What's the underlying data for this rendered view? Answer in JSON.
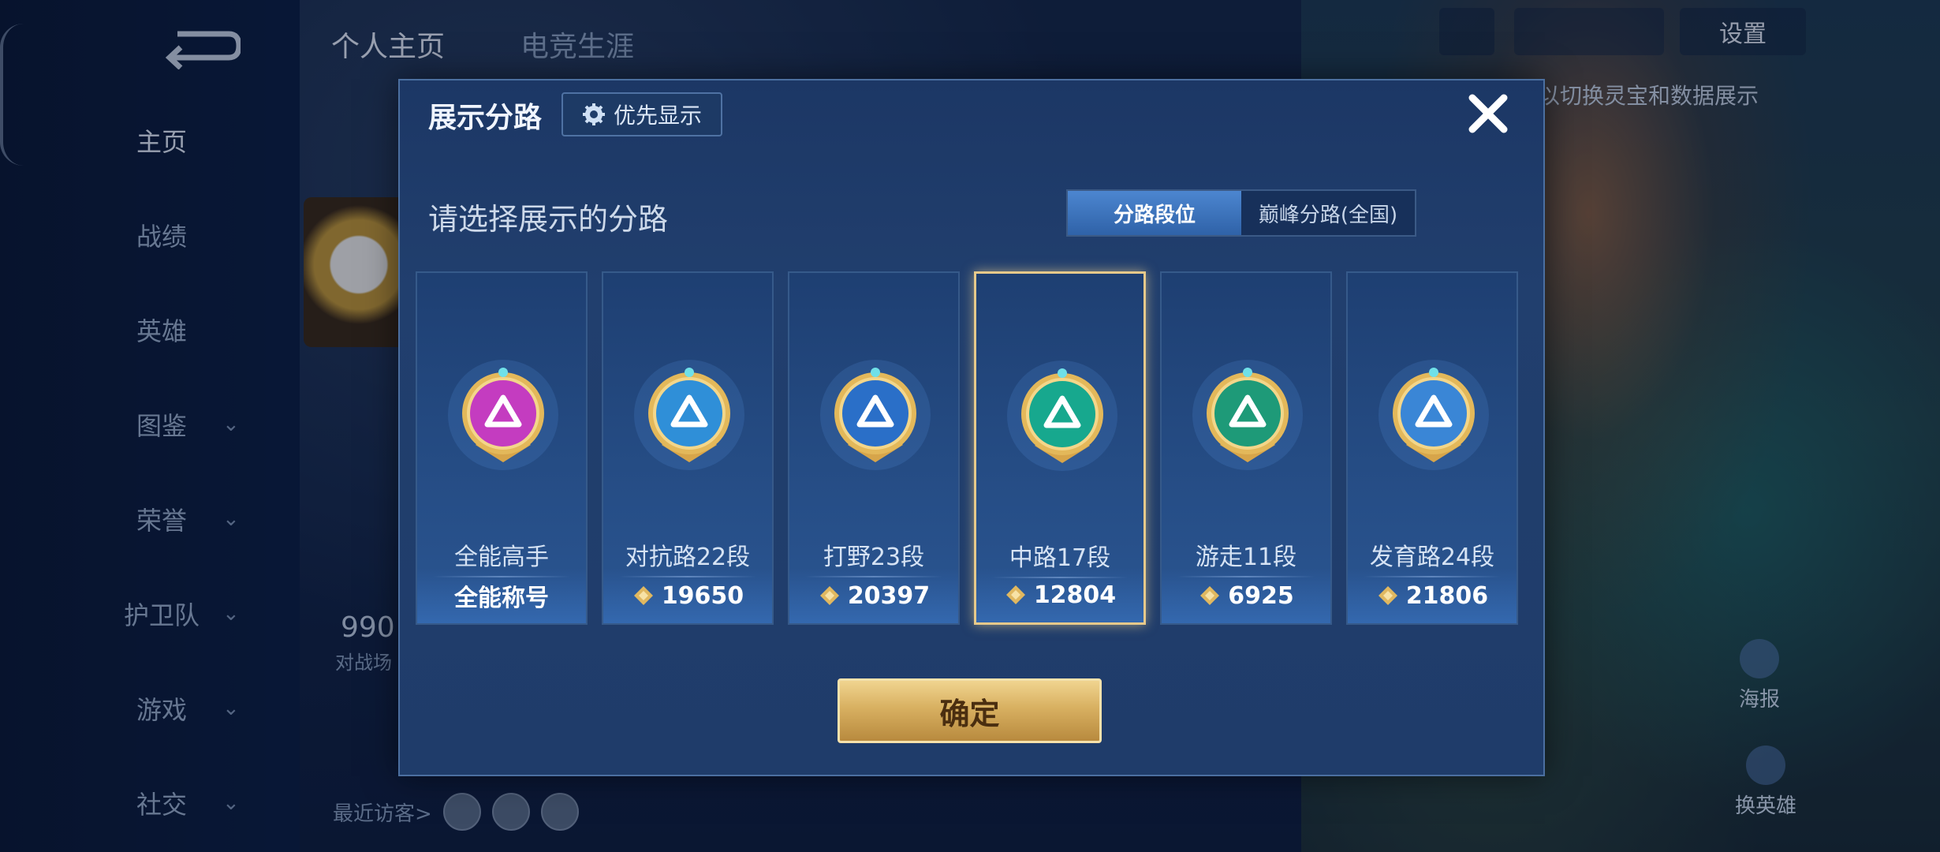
{
  "nav": {
    "items": [
      {
        "label": "主页",
        "chev": false,
        "active": true
      },
      {
        "label": "战绩",
        "chev": false
      },
      {
        "label": "英雄",
        "chev": false
      },
      {
        "label": "图鉴",
        "chev": true
      },
      {
        "label": "荣誉",
        "chev": true
      },
      {
        "label": "护卫队",
        "chev": true
      },
      {
        "label": "游戏",
        "chev": true
      },
      {
        "label": "社交",
        "chev": true
      }
    ]
  },
  "tabs": {
    "profile": "个人主页",
    "career": "电竞生涯"
  },
  "topbar": {
    "settings": "设置"
  },
  "hint": "以切换灵宝和数据展示",
  "side_buttons": {
    "poster": "海报",
    "switch_hero": "换英雄"
  },
  "background": {
    "count": "990",
    "count_sub": "对战场",
    "visitors": "最近访客>"
  },
  "dialog": {
    "title": "展示分路",
    "priority_label": "优先显示",
    "subtitle": "请选择展示的分路",
    "segment": {
      "left": "分路段位",
      "right": "巅峰分路(全国)"
    },
    "confirm": "确定",
    "cards": [
      {
        "name": "全能高手",
        "value": "全能称号",
        "badge_color": "#c43cc0",
        "icon": "all-round-emblem-icon",
        "selected": false,
        "has_points": false
      },
      {
        "name": "对抗路22段",
        "value": "19650",
        "badge_color": "#2f8fd8",
        "icon": "clash-lane-emblem-icon",
        "selected": false,
        "has_points": true
      },
      {
        "name": "打野23段",
        "value": "20397",
        "badge_color": "#2a6fc8",
        "icon": "jungle-emblem-icon",
        "selected": false,
        "has_points": true
      },
      {
        "name": "中路17段",
        "value": "12804",
        "badge_color": "#17a88e",
        "icon": "mid-lane-emblem-icon",
        "selected": true,
        "has_points": true
      },
      {
        "name": "游走11段",
        "value": "6925",
        "badge_color": "#1e9a78",
        "icon": "roam-emblem-icon",
        "selected": false,
        "has_points": true
      },
      {
        "name": "发育路24段",
        "value": "21806",
        "badge_color": "#3a86d6",
        "icon": "farm-lane-emblem-icon",
        "selected": false,
        "has_points": true
      }
    ]
  }
}
